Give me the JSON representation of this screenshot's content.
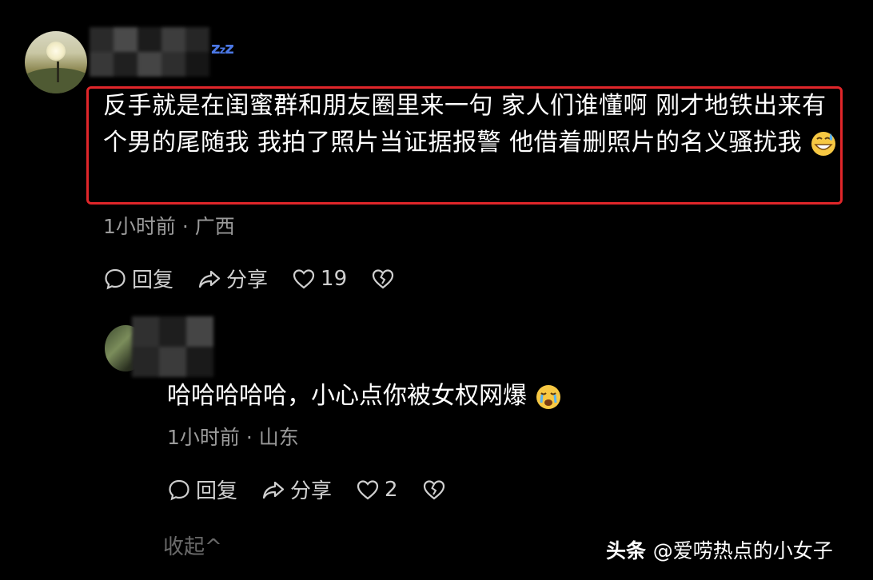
{
  "comment": {
    "status_icon": "zzz",
    "text": "反手就是在闺蜜群和朋友圈里来一句 家人们谁懂啊 刚才地铁出来有个男的尾随我 我拍了照片当证据报警 他借着删照片的名义骚扰我",
    "emoji": "grinning-sweat-emoji",
    "meta": "1小时前 · 广西",
    "actions": {
      "reply_label": "回复",
      "share_label": "分享",
      "like_count": "19"
    }
  },
  "reply": {
    "text": "哈哈哈哈哈，小心点你被女权网爆",
    "emoji": "crying-emoji",
    "meta": "1小时前 · 山东",
    "actions": {
      "reply_label": "回复",
      "share_label": "分享",
      "like_count": "2"
    }
  },
  "collapse_label": "收起^",
  "watermark": {
    "brand": "头条",
    "handle": "@爱唠热点的小女子"
  },
  "colors": {
    "background": "#000000",
    "highlight_box": "#e0262a",
    "meta_text": "#9b9b9b",
    "zzz": "#4b78e6"
  }
}
